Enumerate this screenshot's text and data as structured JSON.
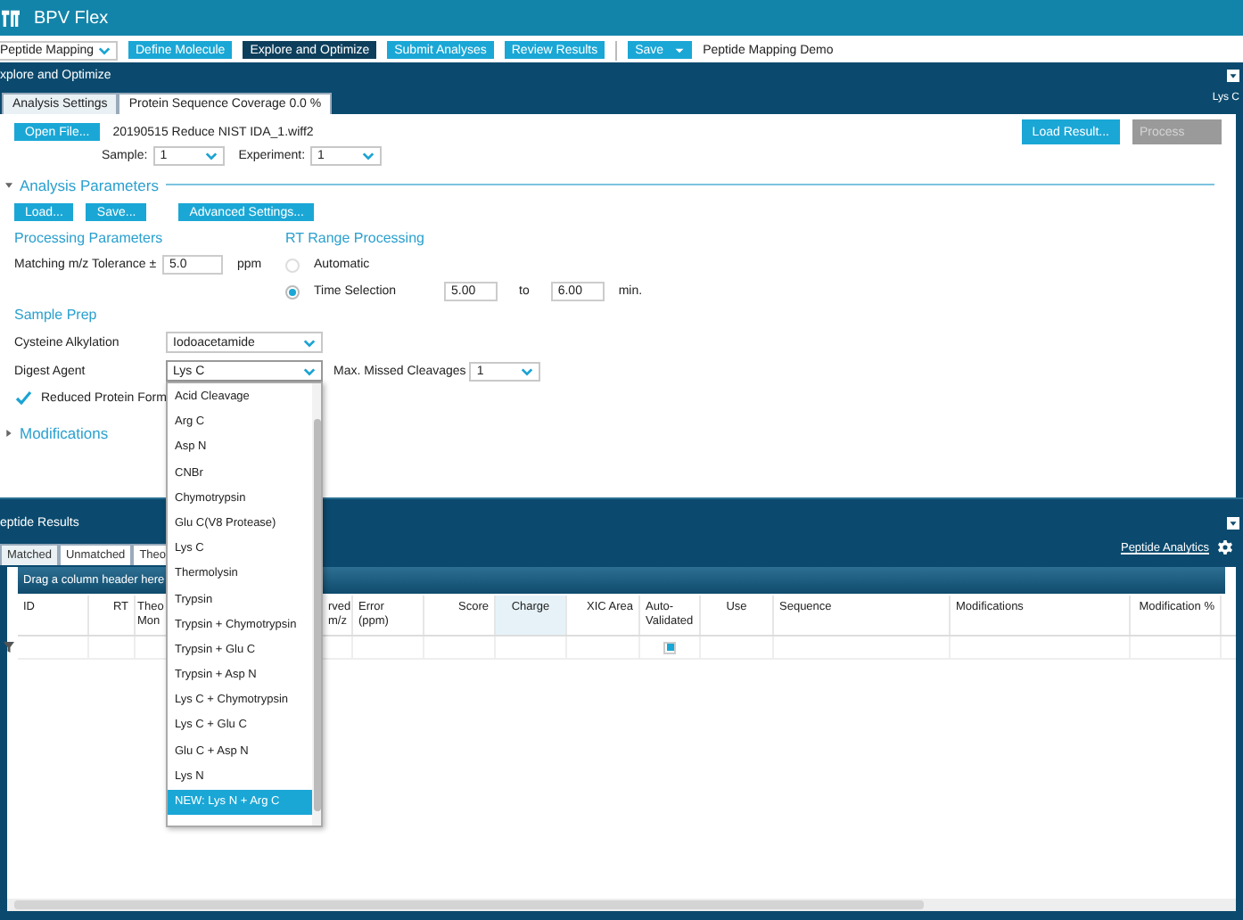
{
  "window": {
    "title": "BPV Flex"
  },
  "toolbar": {
    "workflow": "Peptide Mapping",
    "buttons": [
      {
        "label": "Define Molecule",
        "selected": false
      },
      {
        "label": "Explore and Optimize",
        "selected": true
      },
      {
        "label": "Submit Analyses",
        "selected": false
      },
      {
        "label": "Review Results",
        "selected": false
      }
    ],
    "save": "Save",
    "project": "Peptide Mapping Demo"
  },
  "top_panel": {
    "title": "xplore and Optimize",
    "right_label": "Lys C",
    "tabs": [
      {
        "label": "Analysis Settings",
        "selected": true
      },
      {
        "label": "Protein Sequence Coverage 0.0 %",
        "selected": false
      }
    ],
    "open_file": "Open File...",
    "file_name": "20190515 Reduce NIST IDA_1.wiff2",
    "sample_label": "Sample:",
    "sample": "1",
    "experiment_label": "Experiment:",
    "experiment": "1",
    "load_result": "Load Result...",
    "process": {
      "label": "Process",
      "disabled": true
    },
    "analysis_parameters": {
      "title": "Analysis Parameters",
      "expanded": true,
      "buttons": [
        "Load...",
        "Save...",
        "Advanced Settings..."
      ]
    },
    "processing": {
      "title": "Processing Parameters",
      "tolerance_label": "Matching m/z Tolerance ±",
      "tolerance": "5.0",
      "unit": "ppm"
    },
    "rt_range": {
      "title": "RT Range Processing",
      "options": [
        {
          "label": "Automatic",
          "selected": false
        },
        {
          "label": "Time Selection",
          "selected": true
        }
      ],
      "from": "5.00",
      "to_label": "to",
      "to": "6.00",
      "unit": "min."
    },
    "sample_prep": {
      "title": "Sample Prep",
      "cysteine_label": "Cysteine Alkylation",
      "cysteine": "Iodoacetamide",
      "digest_label": "Digest Agent",
      "digest": "Lys C",
      "missed_label": "Max. Missed Cleavages",
      "missed": "1",
      "reduced_label": "Reduced Protein Form",
      "reduced_checked": true,
      "digest_options": [
        {
          "label": "Acid Cleavage",
          "selected": false
        },
        {
          "label": "Arg C",
          "selected": false
        },
        {
          "label": "Asp N",
          "selected": false
        },
        {
          "label": "CNBr",
          "selected": false
        },
        {
          "label": "Chymotrypsin",
          "selected": false
        },
        {
          "label": "Glu C(V8 Protease)",
          "selected": false
        },
        {
          "label": "Lys C",
          "selected": false
        },
        {
          "label": "Thermolysin",
          "selected": false
        },
        {
          "label": "Trypsin",
          "selected": false
        },
        {
          "label": "Trypsin + Chymotrypsin",
          "selected": false
        },
        {
          "label": "Trypsin + Glu C",
          "selected": false
        },
        {
          "label": "Trypsin + Asp N",
          "selected": false
        },
        {
          "label": "Lys C + Chymotrypsin",
          "selected": false
        },
        {
          "label": "Lys C + Glu C",
          "selected": false
        },
        {
          "label": "Glu C + Asp N",
          "selected": false
        },
        {
          "label": "Lys N",
          "selected": false
        },
        {
          "label": "NEW: Lys N + Arg C",
          "selected": true
        }
      ]
    },
    "modifications": {
      "title": "Modifications",
      "expanded": false
    }
  },
  "results_panel": {
    "title": "eptide Results",
    "tabs": [
      {
        "label": "Matched",
        "selected": true
      },
      {
        "label": "Unmatched",
        "selected": false
      },
      {
        "label": "Theo",
        "selected": false
      }
    ],
    "link": "Peptide Analytics",
    "group_hint": "Drag a column header here",
    "columns": [
      "ID",
      "RT",
      "Theo Mon",
      "rved m/z",
      "Error (ppm)",
      "Score",
      "Charge",
      "XIC Area",
      "Auto-Validated",
      "Use",
      "Sequence",
      "Modifications",
      "Modification %"
    ],
    "filter_auto_validated_checked": true
  }
}
